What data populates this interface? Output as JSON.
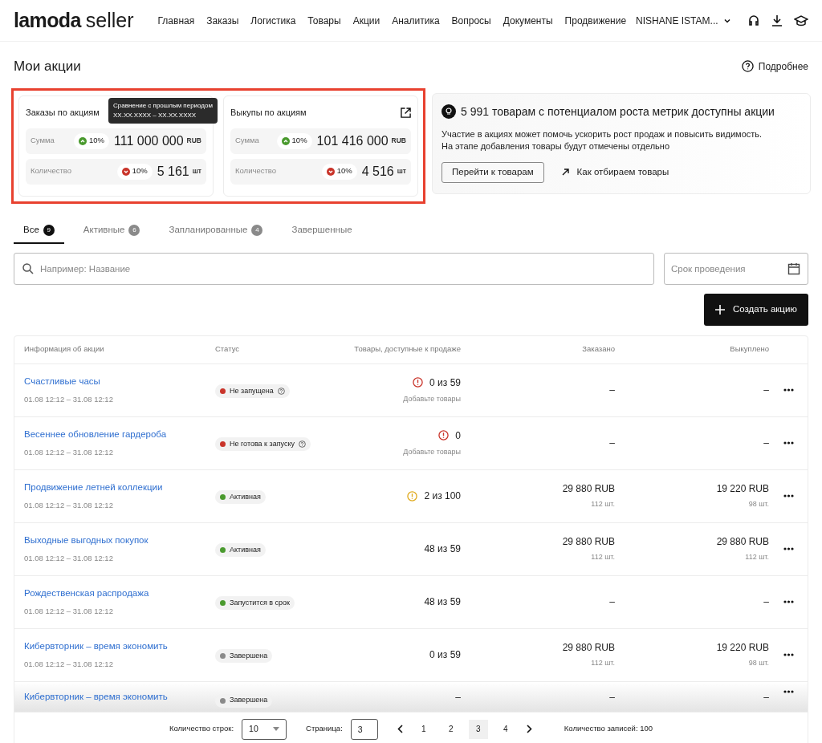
{
  "header": {
    "logo_brand": "lamoda",
    "logo_suffix": "seller",
    "nav": [
      {
        "label": "Главная"
      },
      {
        "label": "Заказы"
      },
      {
        "label": "Логистика"
      },
      {
        "label": "Товары"
      },
      {
        "label": "Акции"
      },
      {
        "label": "Аналитика"
      },
      {
        "label": "Вопросы"
      },
      {
        "label": "Документы"
      },
      {
        "label": "Продвижение"
      }
    ],
    "account": "NISHANE ISTAM..."
  },
  "page": {
    "title": "Мои акции",
    "help_link": "Подробнее"
  },
  "stat_cards": [
    {
      "title": "Заказы по акциям",
      "link_icon": false,
      "metrics": [
        {
          "label": "Сумма",
          "rising": true,
          "change": "10%",
          "value": "111 000 000",
          "unit": "RUB"
        },
        {
          "label": "Количество",
          "rising": false,
          "change": "10%",
          "value": "5 161",
          "unit": "шт"
        }
      ]
    },
    {
      "title": "Выкупы по акциям",
      "link_icon": true,
      "metrics": [
        {
          "label": "Сумма",
          "rising": true,
          "change": "10%",
          "value": "101 416 000",
          "unit": "RUB"
        },
        {
          "label": "Количество",
          "rising": false,
          "change": "10%",
          "value": "4 516",
          "unit": "шт"
        }
      ]
    }
  ],
  "tooltip": {
    "title": "Сравнение с прошлым периодом",
    "period": "XX.XX.XXXX – XX.XX.XXXX"
  },
  "promo": {
    "title": "5 991 товарам с потенциалом роста метрик доступны акции",
    "text": "Участие в акциях может помочь ускорить рост продаж и повысить видимость.\nНа этапе добавления товары будут отмечены отдельно",
    "button": "Перейти к товарам",
    "link": "Как отбираем товары"
  },
  "tabs": [
    {
      "label": "Все",
      "count": "9",
      "selected": true
    },
    {
      "label": "Активные",
      "count": "6",
      "selected": false
    },
    {
      "label": "Запланированные",
      "count": "4",
      "selected": false
    },
    {
      "label": "Завершенные",
      "selected": false
    }
  ],
  "search": {
    "placeholder": "Например: Название"
  },
  "date_filter": {
    "placeholder": "Срок проведения"
  },
  "create_button": "Создать акцию",
  "table": {
    "columns": [
      "Информация об акции",
      "Статус",
      "Товары, доступные к продаже",
      "Заказано",
      "Выкуплено"
    ],
    "rows": [
      {
        "name": "Счастливые часы",
        "dates": "01.08 12:12 – 31.08 12:12",
        "status": {
          "label": "Не запущена",
          "color": "#c9342a",
          "help": true
        },
        "available": {
          "text": "0 из 59",
          "error": true,
          "hint": "Добавьте товары"
        },
        "ordered": {
          "amount": "–"
        },
        "bought": {
          "amount": "–"
        }
      },
      {
        "name": "Весеннее обновление гардероба",
        "dates": "01.08 12:12 – 31.08 12:12",
        "status": {
          "label": "Не готова к запуску",
          "color": "#c9342a",
          "help": true
        },
        "available": {
          "text": "0",
          "error": true,
          "hint": "Добавьте товары"
        },
        "ordered": {
          "amount": "–"
        },
        "bought": {
          "amount": "–"
        }
      },
      {
        "name": "Продвижение летней коллекции",
        "dates": "01.08 12:12 – 31.08 12:12",
        "status": {
          "label": "Активная",
          "color": "#4a9a2e",
          "help": false
        },
        "available": {
          "text": "2 из 100",
          "error": false,
          "warning": true
        },
        "ordered": {
          "amount": "29 880 RUB",
          "qty": "112 шт."
        },
        "bought": {
          "amount": "19 220 RUB",
          "qty": "98 шт."
        }
      },
      {
        "name": "Выходные выгодных покупок",
        "dates": "01.08 12:12 – 31.08 12:12",
        "status": {
          "label": "Активная",
          "color": "#4a9a2e",
          "help": false
        },
        "available": {
          "text": "48 из 59",
          "error": false,
          "warning": false
        },
        "ordered": {
          "amount": "29 880 RUB",
          "qty": "112 шт."
        },
        "bought": {
          "amount": "29 880 RUB",
          "qty": "112 шт."
        }
      },
      {
        "name": "Рождественская распродажа",
        "dates": "01.08 12:12 – 31.08 12:12",
        "status": {
          "label": "Запустится в срок",
          "color": "#4a9a2e",
          "help": false
        },
        "available": {
          "text": "48 из 59",
          "error": false,
          "warning": false
        },
        "ordered": {
          "amount": "–"
        },
        "bought": {
          "amount": "–"
        }
      },
      {
        "name": "Кибервторник – время экономить",
        "dates": "01.08 12:12 – 31.08 12:12",
        "status": {
          "label": "Завершена",
          "color": "#8a8a8a",
          "help": false
        },
        "available": {
          "text": "0 из 59",
          "error": false,
          "warning": false
        },
        "ordered": {
          "amount": "29 880 RUB",
          "qty": "112 шт."
        },
        "bought": {
          "amount": "19 220 RUB",
          "qty": "98 шт."
        }
      },
      {
        "name": "Кибервторник – время экономить",
        "status": {
          "label": "Завершена",
          "color": "#8a8a8a",
          "help": false
        },
        "available": {
          "text": "–",
          "error": false,
          "warning": false
        },
        "ordered": {
          "amount": "–"
        },
        "bought": {
          "amount": "–"
        },
        "cut_off": true
      }
    ]
  },
  "pagination": {
    "rows_label": "Количество строк:",
    "rows_value": "10",
    "page_label": "Страница:",
    "page_value": "3",
    "pages": [
      {
        "label": "1",
        "selected": false
      },
      {
        "label": "2",
        "selected": false
      },
      {
        "label": "3",
        "selected": true
      },
      {
        "label": "4",
        "selected": false
      }
    ],
    "total": "Количество записей: 100"
  }
}
